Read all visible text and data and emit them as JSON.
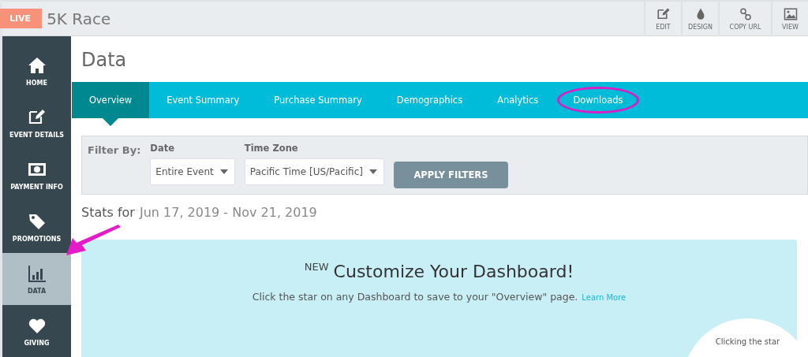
{
  "header": {
    "badge": "LIVE",
    "title": "5K Race",
    "actions": [
      {
        "label": "EDIT"
      },
      {
        "label": "DESIGN"
      },
      {
        "label": "COPY URL"
      },
      {
        "label": "VIEW"
      }
    ]
  },
  "sidebar": {
    "items": [
      {
        "label": "HOME",
        "selected": false
      },
      {
        "label": "EVENT DETAILS",
        "selected": false
      },
      {
        "label": "PAYMENT INFO",
        "selected": false
      },
      {
        "label": "PROMOTIONS",
        "selected": false
      },
      {
        "label": "DATA",
        "selected": true
      },
      {
        "label": "GIVING",
        "selected": false
      }
    ]
  },
  "page_title": "Data",
  "tabs": [
    {
      "label": "Overview",
      "selected": true,
      "circled": false
    },
    {
      "label": "Event Summary",
      "selected": false,
      "circled": false
    },
    {
      "label": "Purchase Summary",
      "selected": false,
      "circled": false
    },
    {
      "label": "Demographics",
      "selected": false,
      "circled": false
    },
    {
      "label": "Analytics",
      "selected": false,
      "circled": false
    },
    {
      "label": "Downloads",
      "selected": false,
      "circled": true
    }
  ],
  "filters": {
    "label": "Filter By:",
    "date": {
      "label": "Date",
      "value": "Entire Event"
    },
    "time_zone": {
      "label": "Time Zone",
      "value": "Pacific Time [US/Pacific]"
    },
    "apply_button": "APPLY FILTERS"
  },
  "stats": {
    "prefix": "Stats for",
    "range": "Jun 17, 2019 - Nov 21, 2019"
  },
  "banner": {
    "badge": "NEW",
    "title": "Customize Your Dashboard!",
    "text": "Click the star on any Dashboard to save to your \"Overview\" page.",
    "link": "Learn More",
    "bubble": "Clicking the star"
  }
}
